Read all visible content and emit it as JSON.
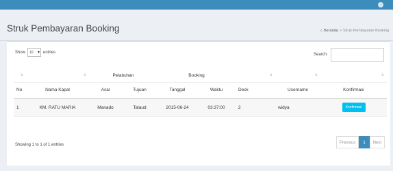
{
  "header": {
    "title": "Struk Pembayaran Booking",
    "breadcrumb": {
      "home": "Beranda",
      "current": "Struk Pembayaran Booking"
    }
  },
  "controls": {
    "length_prefix": "Show",
    "length_value": "10",
    "length_suffix": "entries",
    "search_label": "Search:"
  },
  "table": {
    "group_headers": {
      "pelabuhan": "Pelabuhan",
      "booking": "Booking"
    },
    "columns": [
      "No",
      "Nama Kapal",
      "Asal",
      "Tujuan",
      "Tanggal",
      "Waktu",
      "Deck",
      "Username",
      "Konfirmasi"
    ],
    "rows": [
      {
        "no": "1",
        "nama_kapal": "KM. RATU MARIA",
        "asal": "Manado",
        "tujuan": "Talaud",
        "tanggal": "2015-06-24",
        "waktu": "03:37:00",
        "deck": "2",
        "username": "widya",
        "konfirmasi": "Konfirmasi"
      }
    ]
  },
  "footer": {
    "info": "Showing 1 to 1 of 1 entries",
    "pagination": {
      "previous": "Previous",
      "current": "1",
      "next": "Next"
    }
  },
  "colors": {
    "accent": "#3c8dbc",
    "button": "#00c0ef"
  }
}
